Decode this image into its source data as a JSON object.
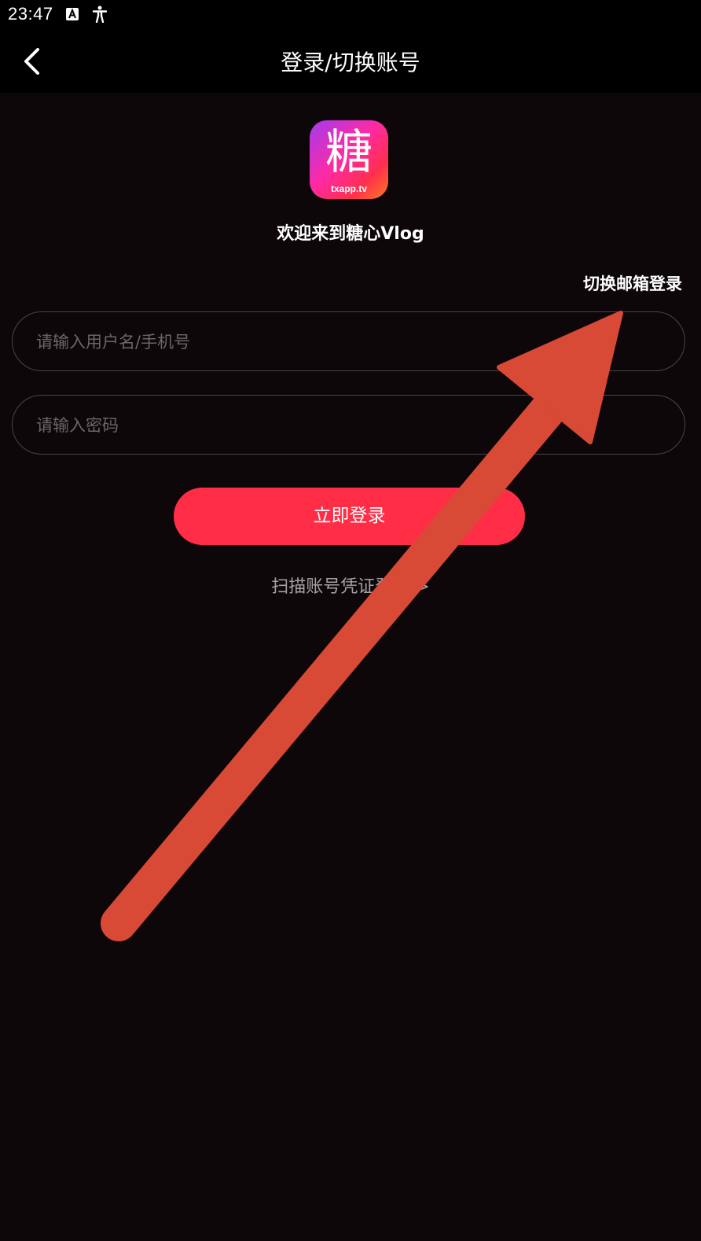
{
  "status_bar": {
    "time": "23:47",
    "icons": [
      "a-notification-icon",
      "accessibility-icon"
    ]
  },
  "app_bar": {
    "title": "登录/切换账号",
    "back_icon": "chevron-left-icon"
  },
  "logo": {
    "glyph": "糖",
    "domain": "txapp.tv"
  },
  "welcome_text": "欢迎来到糖心Vlog",
  "switch_email_label": "切换邮箱登录",
  "form": {
    "username_placeholder": "请输入用户名/手机号",
    "username_value": "",
    "password_placeholder": "请输入密码",
    "password_value": "",
    "login_label": "立即登录"
  },
  "scan_link_label": "扫描账号凭证登录 >",
  "colors": {
    "background": "#0d070a",
    "bar": "#000000",
    "accent": "#ff2d45",
    "input_border": "#4a4446",
    "placeholder": "#6b6668",
    "annotation_arrow": "#d84a35"
  }
}
